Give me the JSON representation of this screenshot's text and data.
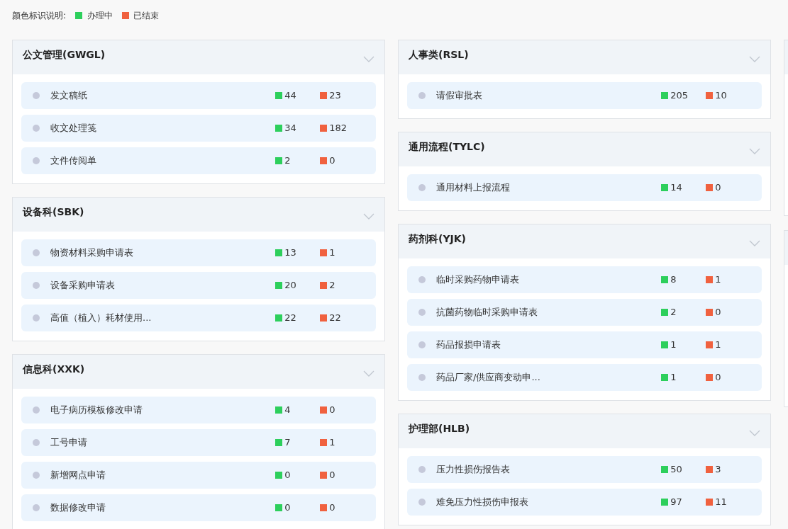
{
  "legend": {
    "label": "颜色标识说明:",
    "items": [
      {
        "label": "办理中",
        "color": "#2dcf5c"
      },
      {
        "label": "已结束",
        "color": "#f0613f"
      }
    ]
  },
  "columns": [
    [
      {
        "title": "公文管理(GWGL)",
        "rows": [
          {
            "name": "发文稿纸",
            "active": "44",
            "done": "23"
          },
          {
            "name": "收文处理笺",
            "active": "34",
            "done": "182"
          },
          {
            "name": "文件传阅单",
            "active": "2",
            "done": "0"
          }
        ]
      },
      {
        "title": "设备科(SBK)",
        "rows": [
          {
            "name": "物资材料采购申请表",
            "active": "13",
            "done": "1"
          },
          {
            "name": "设备采购申请表",
            "active": "20",
            "done": "2"
          },
          {
            "name": "高值（植入）耗材使用...",
            "active": "22",
            "done": "22"
          }
        ]
      },
      {
        "title": "信息科(XXK)",
        "rows": [
          {
            "name": "电子病历模板修改申请",
            "active": "4",
            "done": "0"
          },
          {
            "name": "工号申请",
            "active": "7",
            "done": "1"
          },
          {
            "name": "新增网点申请",
            "active": "0",
            "done": "0"
          },
          {
            "name": "数据修改申请",
            "active": "0",
            "done": "0"
          }
        ]
      }
    ],
    [
      {
        "title": "人事类(RSL)",
        "rows": [
          {
            "name": "请假审批表",
            "active": "205",
            "done": "10"
          }
        ]
      },
      {
        "title": "通用流程(TYLC)",
        "rows": [
          {
            "name": "通用材料上报流程",
            "active": "14",
            "done": "0"
          }
        ]
      },
      {
        "title": "药剂科(YJK)",
        "rows": [
          {
            "name": "临时采购药物申请表",
            "active": "8",
            "done": "1"
          },
          {
            "name": "抗菌药物临时采购申请表",
            "active": "2",
            "done": "0"
          },
          {
            "name": "药品报损申请表",
            "active": "1",
            "done": "1"
          },
          {
            "name": "药品厂家/供应商变动申...",
            "active": "1",
            "done": "0"
          }
        ]
      },
      {
        "title": "护理部(HLB)",
        "rows": [
          {
            "name": "压力性损伤报告表",
            "active": "50",
            "done": "3"
          },
          {
            "name": "难免压力性损伤申报表",
            "active": "97",
            "done": "11"
          }
        ]
      }
    ]
  ]
}
